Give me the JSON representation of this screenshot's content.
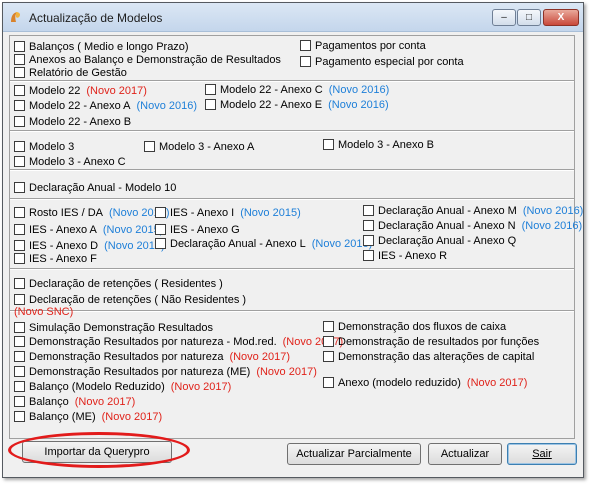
{
  "window": {
    "title": "Actualização de Modelos",
    "min": "–",
    "max": "□",
    "close": "X"
  },
  "row1": {
    "balancos": "Balanços ( Medio e longo Prazo)",
    "anexos_balanco": "Anexos ao Balanço e Demonstração de Resultados",
    "relatorio": "Relatório de Gestão",
    "pagamentos": "Pagamentos por conta",
    "pagamento_especial": "Pagamento especial por conta"
  },
  "m22": {
    "modelo22": "Modelo  22",
    "modelo22_tag": "(Novo 2017)",
    "anexo_a": "Modelo 22 - Anexo A",
    "anexo_a_tag": "(Novo 2016)",
    "anexo_b": "Modelo 22 - Anexo B",
    "anexo_c": "Modelo 22 - Anexo C",
    "anexo_c_tag": "(Novo 2016)",
    "anexo_e": "Modelo 22 - Anexo E",
    "anexo_e_tag": "(Novo 2016)"
  },
  "m3": {
    "modelo3": "Modelo 3",
    "anexo_c": "Modelo 3 - Anexo C",
    "anexo_a": "Modelo 3 - Anexo A",
    "anexo_b": "Modelo 3 - Anexo B"
  },
  "m10": {
    "label": "Declaração Anual - Modelo 10"
  },
  "ies": {
    "rosto": "Rosto IES / DA",
    "rosto_tag": "(Novo 2015)",
    "anexo_a": "IES - Anexo A",
    "anexo_a_tag": "(Novo 2015)",
    "anexo_d": "IES - Anexo D",
    "anexo_d_tag": "(Novo 2015)",
    "anexo_f": "IES - Anexo F",
    "anexo_i": "IES - Anexo I",
    "anexo_i_tag": "(Novo 2015)",
    "anexo_g": "IES - Anexo G",
    "decl_l": "Declaração Anual - Anexo L",
    "decl_l_tag": "(Novo 2016)",
    "decl_m": "Declaração Anual - Anexo M",
    "decl_m_tag": "(Novo 2016)",
    "decl_n": "Declaração Anual - Anexo N",
    "decl_n_tag": "(Novo 2016)",
    "decl_q": "Declaração Anual - Anexo Q",
    "anexo_r": "IES - Anexo R"
  },
  "retencoes": {
    "residentes": "Declaração de retenções ( Residentes )",
    "nao_residentes": "Declaração de retenções ( Não Residentes )"
  },
  "snc": {
    "header": "(Novo SNC)",
    "simulacao": "Simulação Demonstração Resultados",
    "dr_modred": "Demonstração Resultados por natureza - Mod.red.",
    "dr_modred_tag": "(Novo 2017)",
    "dr_natureza": "Demonstração Resultados por natureza",
    "dr_natureza_tag": "(Novo 2017)",
    "dr_me": "Demonstração Resultados por natureza (ME)",
    "dr_me_tag": "(Novo 2017)",
    "balanco_mr": "Balanço (Modelo Reduzido)",
    "balanco_mr_tag": "(Novo 2017)",
    "balanco": "Balanço",
    "balanco_tag": "(Novo 2017)",
    "balanco_me": "Balanço (ME)",
    "balanco_me_tag": "(Novo 2017)",
    "fluxos": "Demonstração dos fluxos de caixa",
    "funcoes": "Demonstração de resultados por funções",
    "capital": "Demonstração das alterações de capital",
    "anexo_mr": "Anexo (modelo reduzido)",
    "anexo_mr_tag": "(Novo 2017)"
  },
  "buttons": {
    "importar": "Importar da Querypro",
    "parcial": "Actualizar Parcialmente",
    "actualizar": "Actualizar",
    "sair": "Sair"
  }
}
